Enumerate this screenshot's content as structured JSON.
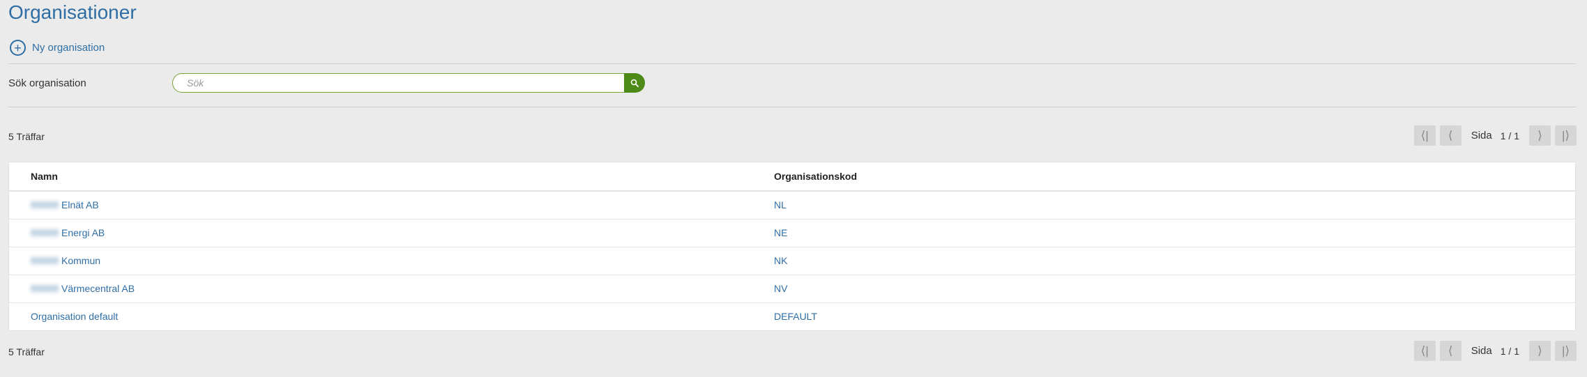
{
  "page": {
    "title": "Organisationer"
  },
  "actions": {
    "new_org_label": "Ny organisation"
  },
  "search": {
    "label": "Sök organisation",
    "placeholder": "Sök",
    "value": ""
  },
  "results": {
    "hits_text": "5 Träffar"
  },
  "pager": {
    "page_label": "Sida",
    "page_value": "1 / 1"
  },
  "table": {
    "columns": [
      "Namn",
      "Organisationskod"
    ],
    "rows": [
      {
        "name": "Elnät AB",
        "code": "NL"
      },
      {
        "name": "Energi AB",
        "code": "NE"
      },
      {
        "name": "Kommun",
        "code": "NK"
      },
      {
        "name": "Värmecentral AB",
        "code": "NV"
      },
      {
        "name": "Organisation default",
        "code": "DEFAULT"
      }
    ]
  },
  "colors": {
    "link": "#2f6ea5",
    "search_button": "#4d8a17",
    "search_border": "#7aa23a",
    "background": "#ebebeb"
  },
  "icons": {
    "new": "plus-circle-icon",
    "search": "search-icon"
  }
}
